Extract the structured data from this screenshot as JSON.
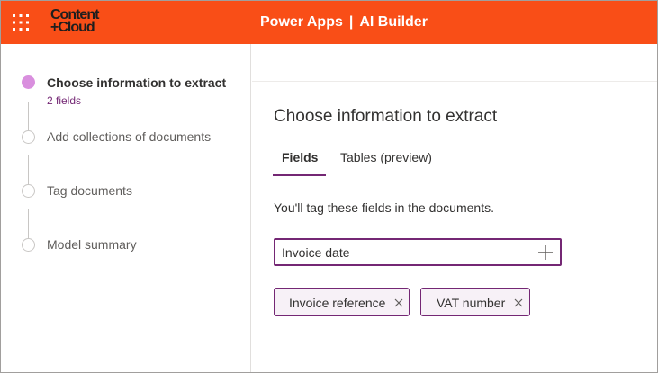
{
  "header": {
    "logo_line1": "Content",
    "logo_line2": "+Cloud",
    "app_name": "Power Apps",
    "separator": "|",
    "section": "AI Builder",
    "background_color": "#f94e17"
  },
  "steps": [
    {
      "label": "Choose information to extract",
      "sub": "2 fields",
      "active": true
    },
    {
      "label": "Add collections of documents",
      "active": false
    },
    {
      "label": "Tag documents",
      "active": false
    },
    {
      "label": "Model summary",
      "active": false
    }
  ],
  "main": {
    "title": "Choose information to extract",
    "tabs": [
      {
        "label": "Fields",
        "selected": true
      },
      {
        "label": "Tables (preview)",
        "selected": false
      }
    ],
    "hint": "You'll tag these fields in the documents.",
    "field_input_value": "Invoice date",
    "chips": [
      {
        "label": "Invoice reference"
      },
      {
        "label": "VAT number"
      }
    ]
  },
  "colors": {
    "accent": "#742774",
    "active_step": "#d98fde"
  },
  "icons": [
    "waffle-icon",
    "add-icon",
    "close-icon"
  ]
}
